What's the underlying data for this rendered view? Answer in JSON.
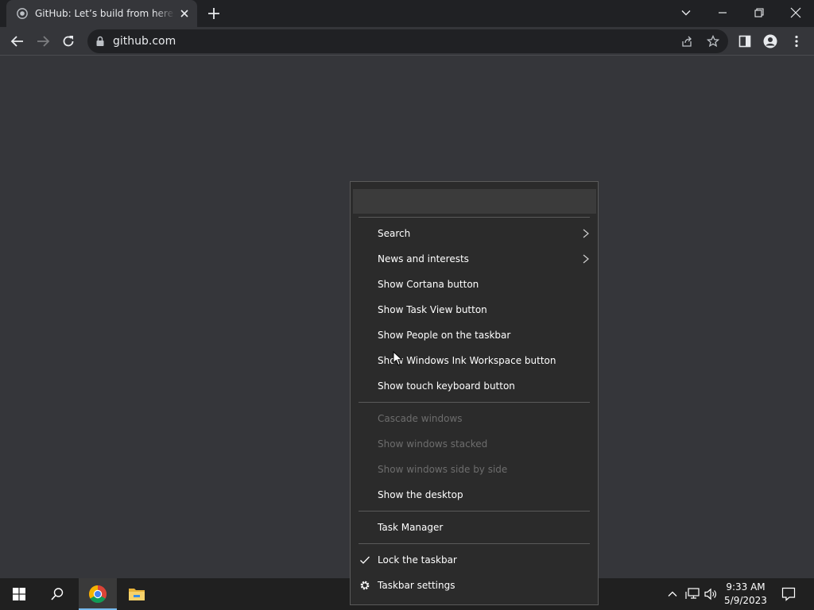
{
  "browser": {
    "tab_title": "GitHub: Let’s build from here · GitHub",
    "url": "github.com"
  },
  "context_menu": {
    "items": [
      {
        "label": "Search",
        "submenu": true,
        "enabled": true
      },
      {
        "label": "News and interests",
        "submenu": true,
        "enabled": true
      },
      {
        "label": "Show Cortana button",
        "enabled": true
      },
      {
        "label": "Show Task View button",
        "enabled": true
      },
      {
        "label": "Show People on the taskbar",
        "enabled": true
      },
      {
        "label": "Show Windows Ink Workspace button",
        "enabled": true
      },
      {
        "label": "Show touch keyboard button",
        "enabled": true
      },
      {
        "label": "Cascade windows",
        "enabled": false
      },
      {
        "label": "Show windows stacked",
        "enabled": false
      },
      {
        "label": "Show windows side by side",
        "enabled": false
      },
      {
        "label": "Show the desktop",
        "enabled": true
      },
      {
        "label": "Task Manager",
        "enabled": true
      },
      {
        "label": "Lock the taskbar",
        "enabled": true,
        "checked": true,
        "icon": "checkmark-icon"
      },
      {
        "label": "Taskbar settings",
        "enabled": true,
        "icon": "gear-icon"
      }
    ]
  },
  "taskbar": {
    "time": "9:33 AM",
    "date": "5/9/2023",
    "apps": [
      "start-icon",
      "search-icon",
      "chrome-icon",
      "file-explorer-icon"
    ],
    "tray_icons": [
      "chevron-up-icon",
      "network-icon",
      "volume-icon",
      "notification-icon"
    ]
  },
  "colors": {
    "tabstrip": "#202124",
    "toolbar": "#35363a",
    "omnibox": "#202124",
    "menu_bg": "#2b2b2b",
    "menu_text": "#ffffff",
    "menu_text_disabled": "#6d6d6d",
    "taskbar": "#202020",
    "chrome_active_underline": "#76b9ed"
  }
}
